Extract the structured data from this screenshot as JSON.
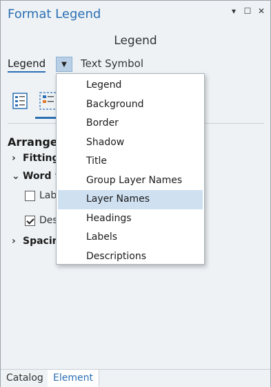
{
  "window": {
    "title": "Format Legend",
    "controls": [
      "▾",
      "☐",
      "✕"
    ]
  },
  "panel": {
    "subtitle": "Legend",
    "tabs": {
      "legend": "Legend",
      "text_symbol": "Text Symbol"
    }
  },
  "icons": [
    "legend-properties-icon",
    "arrangement-icon"
  ],
  "section": {
    "heading": "Arrangen",
    "items": {
      "fitting": "Fitting",
      "word_wrap": "Word ’",
      "labels_cb": "Lab",
      "descriptions_cb": "Des",
      "spacing": "Spacin"
    },
    "labels_checked": false,
    "descriptions_checked": true
  },
  "dropdown": {
    "items": [
      "Legend",
      "Background",
      "Border",
      "Shadow",
      "Title",
      "Group Layer Names",
      "Layer Names",
      "Headings",
      "Labels",
      "Descriptions"
    ],
    "selected": "Layer Names"
  },
  "bottom_tabs": {
    "catalog": "Catalog",
    "element": "Element"
  },
  "colors": {
    "accent": "#2b6fb3",
    "selection": "#cfe0f1",
    "panel_bg": "#eef2f5"
  }
}
